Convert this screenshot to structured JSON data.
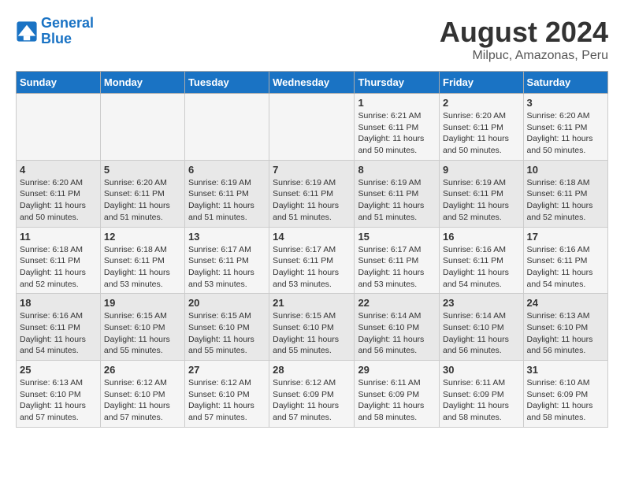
{
  "header": {
    "logo_line1": "General",
    "logo_line2": "Blue",
    "title": "August 2024",
    "subtitle": "Milpuc, Amazonas, Peru"
  },
  "days_of_week": [
    "Sunday",
    "Monday",
    "Tuesday",
    "Wednesday",
    "Thursday",
    "Friday",
    "Saturday"
  ],
  "weeks": [
    [
      {
        "day": "",
        "info": ""
      },
      {
        "day": "",
        "info": ""
      },
      {
        "day": "",
        "info": ""
      },
      {
        "day": "",
        "info": ""
      },
      {
        "day": "1",
        "info": "Sunrise: 6:21 AM\nSunset: 6:11 PM\nDaylight: 11 hours\nand 50 minutes."
      },
      {
        "day": "2",
        "info": "Sunrise: 6:20 AM\nSunset: 6:11 PM\nDaylight: 11 hours\nand 50 minutes."
      },
      {
        "day": "3",
        "info": "Sunrise: 6:20 AM\nSunset: 6:11 PM\nDaylight: 11 hours\nand 50 minutes."
      }
    ],
    [
      {
        "day": "4",
        "info": "Sunrise: 6:20 AM\nSunset: 6:11 PM\nDaylight: 11 hours\nand 50 minutes."
      },
      {
        "day": "5",
        "info": "Sunrise: 6:20 AM\nSunset: 6:11 PM\nDaylight: 11 hours\nand 51 minutes."
      },
      {
        "day": "6",
        "info": "Sunrise: 6:19 AM\nSunset: 6:11 PM\nDaylight: 11 hours\nand 51 minutes."
      },
      {
        "day": "7",
        "info": "Sunrise: 6:19 AM\nSunset: 6:11 PM\nDaylight: 11 hours\nand 51 minutes."
      },
      {
        "day": "8",
        "info": "Sunrise: 6:19 AM\nSunset: 6:11 PM\nDaylight: 11 hours\nand 51 minutes."
      },
      {
        "day": "9",
        "info": "Sunrise: 6:19 AM\nSunset: 6:11 PM\nDaylight: 11 hours\nand 52 minutes."
      },
      {
        "day": "10",
        "info": "Sunrise: 6:18 AM\nSunset: 6:11 PM\nDaylight: 11 hours\nand 52 minutes."
      }
    ],
    [
      {
        "day": "11",
        "info": "Sunrise: 6:18 AM\nSunset: 6:11 PM\nDaylight: 11 hours\nand 52 minutes."
      },
      {
        "day": "12",
        "info": "Sunrise: 6:18 AM\nSunset: 6:11 PM\nDaylight: 11 hours\nand 53 minutes."
      },
      {
        "day": "13",
        "info": "Sunrise: 6:17 AM\nSunset: 6:11 PM\nDaylight: 11 hours\nand 53 minutes."
      },
      {
        "day": "14",
        "info": "Sunrise: 6:17 AM\nSunset: 6:11 PM\nDaylight: 11 hours\nand 53 minutes."
      },
      {
        "day": "15",
        "info": "Sunrise: 6:17 AM\nSunset: 6:11 PM\nDaylight: 11 hours\nand 53 minutes."
      },
      {
        "day": "16",
        "info": "Sunrise: 6:16 AM\nSunset: 6:11 PM\nDaylight: 11 hours\nand 54 minutes."
      },
      {
        "day": "17",
        "info": "Sunrise: 6:16 AM\nSunset: 6:11 PM\nDaylight: 11 hours\nand 54 minutes."
      }
    ],
    [
      {
        "day": "18",
        "info": "Sunrise: 6:16 AM\nSunset: 6:11 PM\nDaylight: 11 hours\nand 54 minutes."
      },
      {
        "day": "19",
        "info": "Sunrise: 6:15 AM\nSunset: 6:10 PM\nDaylight: 11 hours\nand 55 minutes."
      },
      {
        "day": "20",
        "info": "Sunrise: 6:15 AM\nSunset: 6:10 PM\nDaylight: 11 hours\nand 55 minutes."
      },
      {
        "day": "21",
        "info": "Sunrise: 6:15 AM\nSunset: 6:10 PM\nDaylight: 11 hours\nand 55 minutes."
      },
      {
        "day": "22",
        "info": "Sunrise: 6:14 AM\nSunset: 6:10 PM\nDaylight: 11 hours\nand 56 minutes."
      },
      {
        "day": "23",
        "info": "Sunrise: 6:14 AM\nSunset: 6:10 PM\nDaylight: 11 hours\nand 56 minutes."
      },
      {
        "day": "24",
        "info": "Sunrise: 6:13 AM\nSunset: 6:10 PM\nDaylight: 11 hours\nand 56 minutes."
      }
    ],
    [
      {
        "day": "25",
        "info": "Sunrise: 6:13 AM\nSunset: 6:10 PM\nDaylight: 11 hours\nand 57 minutes."
      },
      {
        "day": "26",
        "info": "Sunrise: 6:12 AM\nSunset: 6:10 PM\nDaylight: 11 hours\nand 57 minutes."
      },
      {
        "day": "27",
        "info": "Sunrise: 6:12 AM\nSunset: 6:10 PM\nDaylight: 11 hours\nand 57 minutes."
      },
      {
        "day": "28",
        "info": "Sunrise: 6:12 AM\nSunset: 6:09 PM\nDaylight: 11 hours\nand 57 minutes."
      },
      {
        "day": "29",
        "info": "Sunrise: 6:11 AM\nSunset: 6:09 PM\nDaylight: 11 hours\nand 58 minutes."
      },
      {
        "day": "30",
        "info": "Sunrise: 6:11 AM\nSunset: 6:09 PM\nDaylight: 11 hours\nand 58 minutes."
      },
      {
        "day": "31",
        "info": "Sunrise: 6:10 AM\nSunset: 6:09 PM\nDaylight: 11 hours\nand 58 minutes."
      }
    ]
  ]
}
